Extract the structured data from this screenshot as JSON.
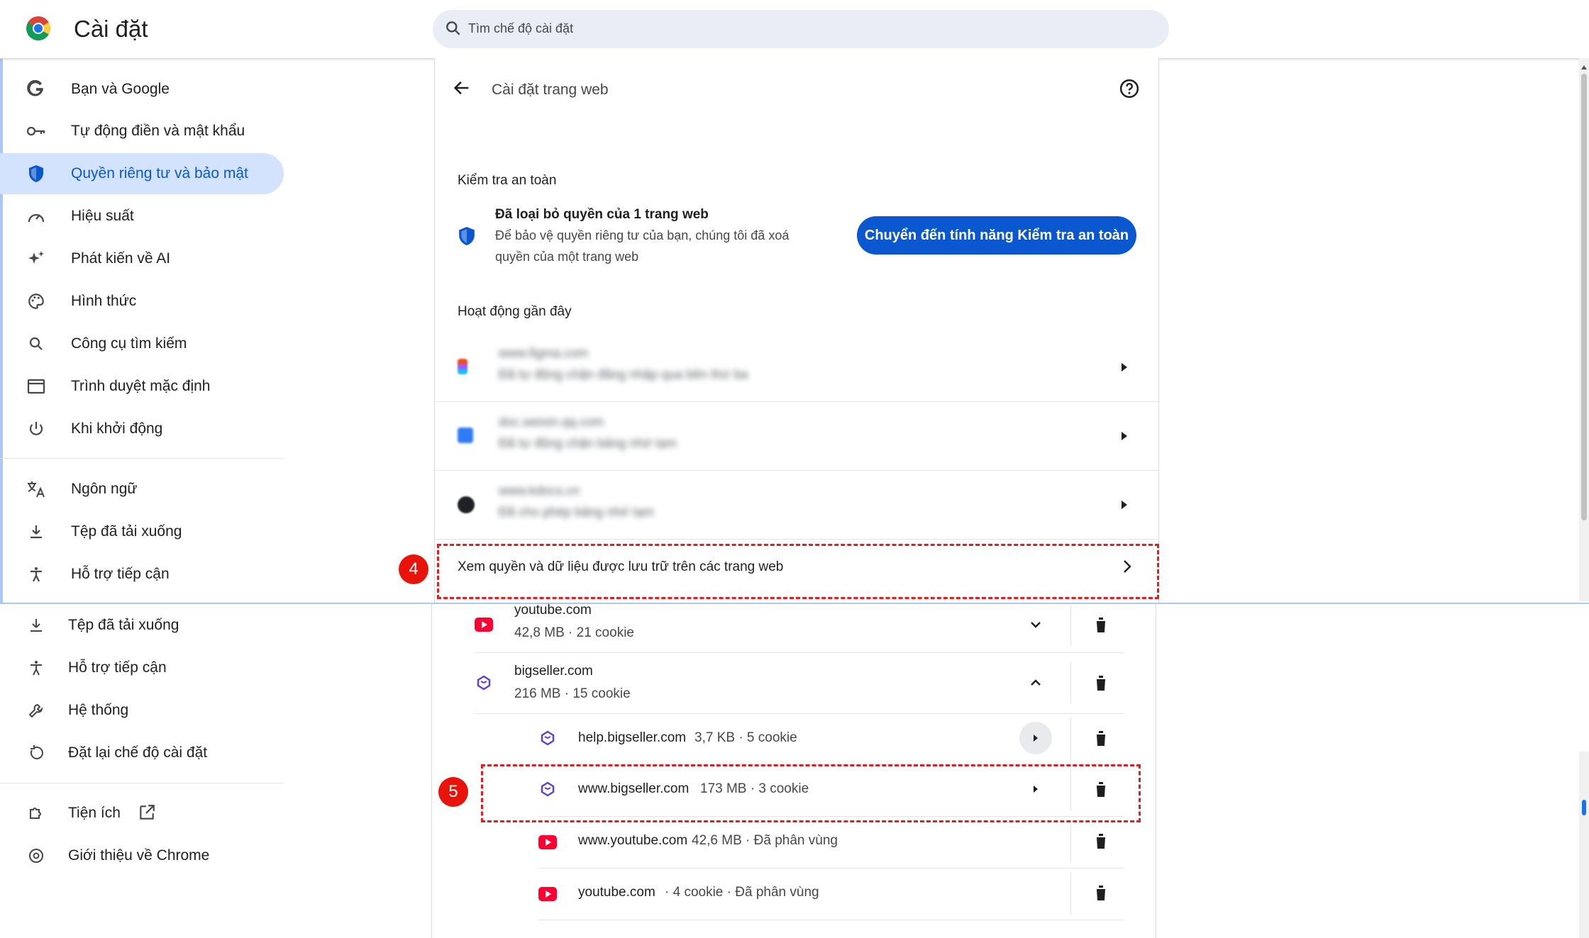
{
  "header": {
    "title": "Cài đặt",
    "search_placeholder": "Tìm chế độ cài đặt"
  },
  "sidebar_top": {
    "items": [
      {
        "label": "Bạn và Google"
      },
      {
        "label": "Tự động điền và mật khẩu"
      },
      {
        "label": "Quyền riêng tư và bảo mật"
      },
      {
        "label": "Hiệu suất"
      },
      {
        "label": "Phát kiến về AI"
      },
      {
        "label": "Hình thức"
      },
      {
        "label": "Công cụ tìm kiếm"
      },
      {
        "label": "Trình duyệt mặc định"
      },
      {
        "label": "Khi khởi động"
      },
      {
        "label": "Ngôn ngữ"
      },
      {
        "label": "Tệp đã tải xuống"
      },
      {
        "label": "Hỗ trợ tiếp cận"
      }
    ]
  },
  "sidebar_bottom": {
    "items": [
      {
        "label": "Tệp đã tải xuống"
      },
      {
        "label": "Hỗ trợ tiếp cận"
      },
      {
        "label": "Hệ thống"
      },
      {
        "label": "Đặt lại chế độ cài đặt"
      },
      {
        "label": "Tiện ích"
      },
      {
        "label": "Giới thiệu về Chrome"
      }
    ]
  },
  "site_settings": {
    "title": "Cài đặt trang web",
    "safety_check_heading": "Kiểm tra an toàn",
    "safety_title": "Đã loại bỏ quyền của 1 trang web",
    "safety_desc_line1": "Để bảo vệ quyền riêng tư của bạn, chúng tôi đã xoá",
    "safety_desc_line2": "quyền của một trang web",
    "safety_button": "Chuyển đến tính năng Kiểm tra an toàn",
    "recent_heading": "Hoạt động gần đây",
    "recent": [
      {
        "site": "www.figma.com",
        "desc": "Đã tự động chặn đăng nhập qua bên thứ ba"
      },
      {
        "site": "doc.weixin.qq.com",
        "desc": "Đã tự động chặn bảng nhớ tạm"
      },
      {
        "site": "www.kdocs.cn",
        "desc": "Đã cho phép bảng nhớ tạm"
      }
    ],
    "view_all": "Xem quyền và dữ liệu được lưu trữ trên các trang web"
  },
  "annotations": {
    "step4": "4",
    "step5": "5"
  },
  "storage": {
    "rows": [
      {
        "site": "youtube.com",
        "detail": "42,8 MB · 21 cookie"
      },
      {
        "site": "bigseller.com",
        "detail": "216 MB · 15 cookie"
      },
      {
        "site": "help.bigseller.com",
        "detail": "3,7 KB · 5 cookie"
      },
      {
        "site": "www.bigseller.com",
        "detail": "173 MB · 3 cookie"
      },
      {
        "site": "www.youtube.com",
        "detail": "42,6 MB · Đã phân vùng"
      },
      {
        "site": "youtube.com",
        "detail": "· 4 cookie · Đã phân vùng"
      }
    ]
  },
  "colors": {
    "accent": "#0b57d0",
    "active_bg": "#d3e3fd",
    "annotation_red": "#e8140c"
  }
}
